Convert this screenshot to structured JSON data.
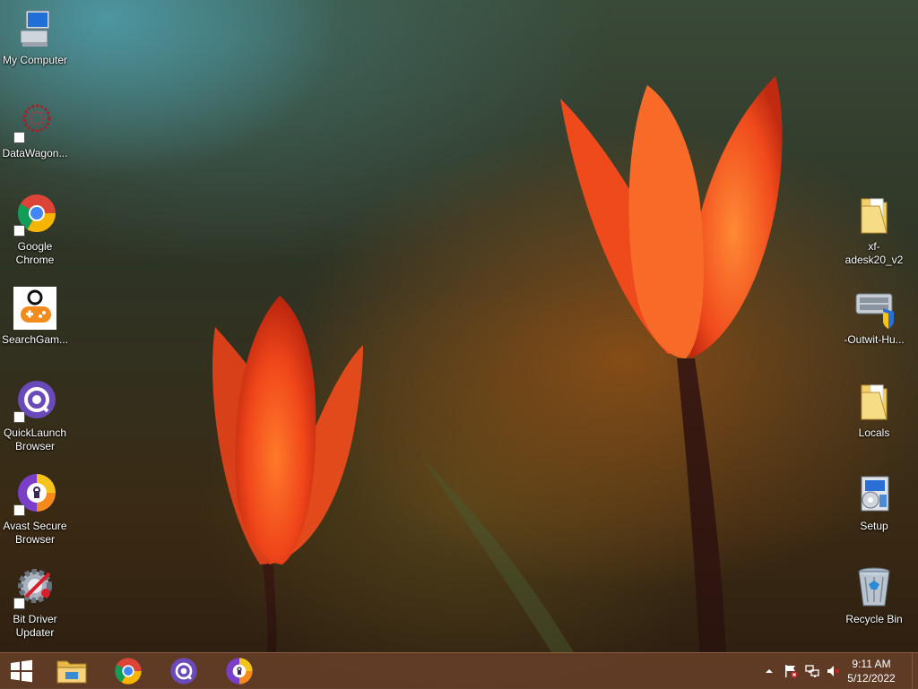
{
  "desktop": {
    "left_icons": [
      {
        "label": "My Computer",
        "icon": "computer-icon"
      },
      {
        "label": "DataWagon...",
        "icon": "datawagon-icon"
      },
      {
        "label": "Google Chrome",
        "icon": "chrome-icon"
      },
      {
        "label": "SearchGam...",
        "icon": "gamepad-icon"
      },
      {
        "label": "QuickLaunch Browser",
        "icon": "quicklaunch-icon"
      },
      {
        "label": "Avast Secure Browser",
        "icon": "avast-icon"
      },
      {
        "label": "Bit Driver Updater",
        "icon": "gear-icon"
      }
    ],
    "right_icons": [
      {
        "label": "xf-adesk20_v2",
        "icon": "folder-icon"
      },
      {
        "label": "-Outwit-Hu...",
        "icon": "installer-icon"
      },
      {
        "label": "Locals",
        "icon": "folder-icon"
      },
      {
        "label": "Setup",
        "icon": "setup-icon"
      },
      {
        "label": "Recycle Bin",
        "icon": "recycle-bin-icon"
      }
    ]
  },
  "taskbar": {
    "pinned": [
      "file-explorer-icon",
      "chrome-icon",
      "quicklaunch-icon",
      "avast-icon"
    ],
    "tray": [
      "chevron-up-icon",
      "flag-icon",
      "network-icon",
      "volume-muted-icon"
    ],
    "clock": {
      "time": "9:11 AM",
      "date": "5/12/2022"
    }
  },
  "colors": {
    "taskbar": "#643e28",
    "accent_orange": "#f25a1a"
  }
}
